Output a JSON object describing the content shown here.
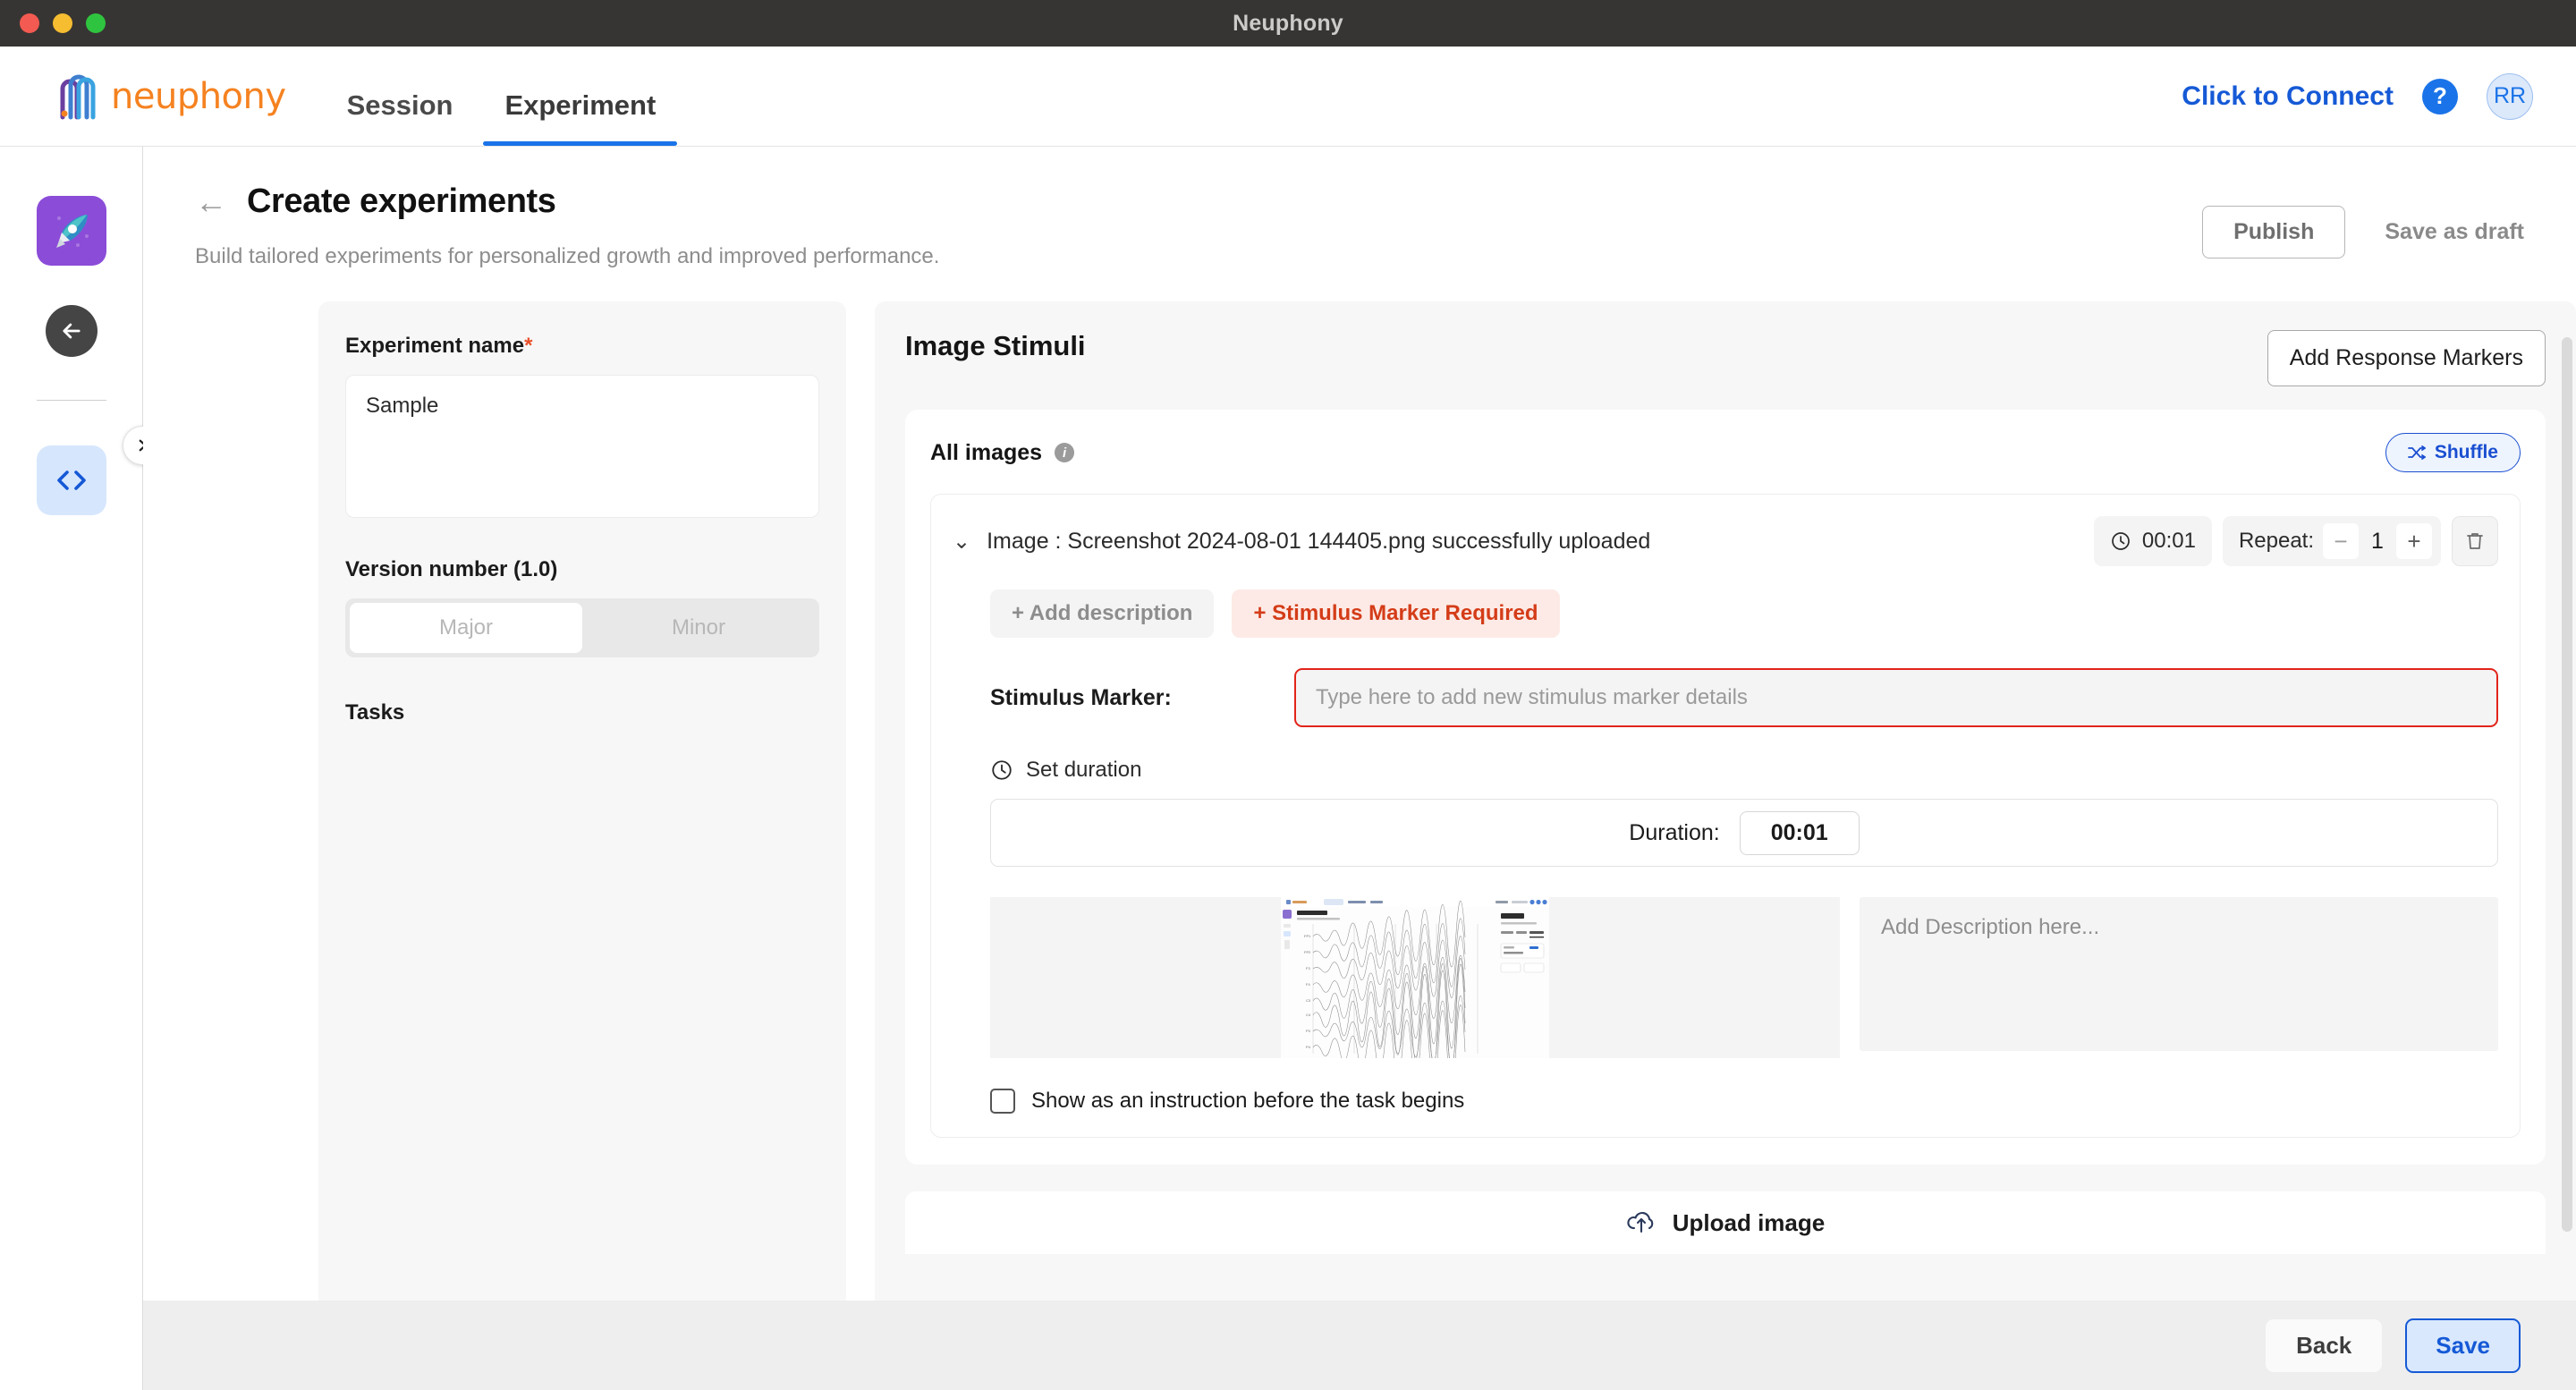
{
  "window": {
    "title": "Neuphony"
  },
  "header": {
    "brand": "neuphony",
    "nav": [
      {
        "label": "Session",
        "active": false
      },
      {
        "label": "Experiment",
        "active": true
      }
    ],
    "connect_label": "Click to Connect",
    "help_label": "?",
    "avatar_initials": "RR",
    "accent_blue": "#1a73e8"
  },
  "rail": {
    "items": [
      {
        "name": "rocket-tile",
        "icon": "rocket-icon"
      },
      {
        "name": "back-button",
        "icon": "arrow-left-icon"
      },
      {
        "name": "code-tile",
        "icon": "code-brackets-icon"
      }
    ],
    "toggle_icon": "chevron-right-icon"
  },
  "page": {
    "back_icon": "arrow-left-icon",
    "title": "Create experiments",
    "subtitle": "Build tailored experiments for personalized growth and improved performance.",
    "publish_label": "Publish",
    "save_draft_label": "Save as draft"
  },
  "left_form": {
    "name_label": "Experiment name",
    "required_mark": "*",
    "name_value": "Sample",
    "version_label": "Version number (1.0)",
    "segments": [
      {
        "label": "Major",
        "selected": true
      },
      {
        "label": "Minor",
        "selected": false
      }
    ],
    "tasks_label": "Tasks"
  },
  "stimuli": {
    "title": "Image Stimuli",
    "add_response_markers_label": "Add Response Markers",
    "all_images_label": "All images",
    "info_icon": "info-icon",
    "shuffle_label": "Shuffle",
    "shuffle_icon": "shuffle-icon",
    "item": {
      "chevron_icon": "chevron-down-icon",
      "name": "Image : Screenshot 2024-08-01 144405.png successfully uploaded",
      "clock_icon": "clock-icon",
      "time": "00:01",
      "repeat_label": "Repeat:",
      "repeat_minus": "−",
      "repeat_value": "1",
      "repeat_plus": "+",
      "delete_icon": "trash-icon",
      "add_description_chip": "+ Add description",
      "stimulus_marker_chip": "+ Stimulus Marker Required",
      "marker_label": "Stimulus Marker:",
      "marker_placeholder": "Type here to add new stimulus marker details",
      "marker_value": "",
      "set_duration_label": "Set duration",
      "duration_label": "Duration:",
      "duration_value": "00:01",
      "description_placeholder": "Add Description here...",
      "description_value": "",
      "instruction_checkbox_label": "Show as an instruction before the task begins",
      "instruction_checked": false,
      "error_color": "#e2241a"
    },
    "upload_label": "Upload image",
    "upload_icon": "cloud-upload-icon"
  },
  "footer": {
    "back_label": "Back",
    "save_label": "Save"
  }
}
